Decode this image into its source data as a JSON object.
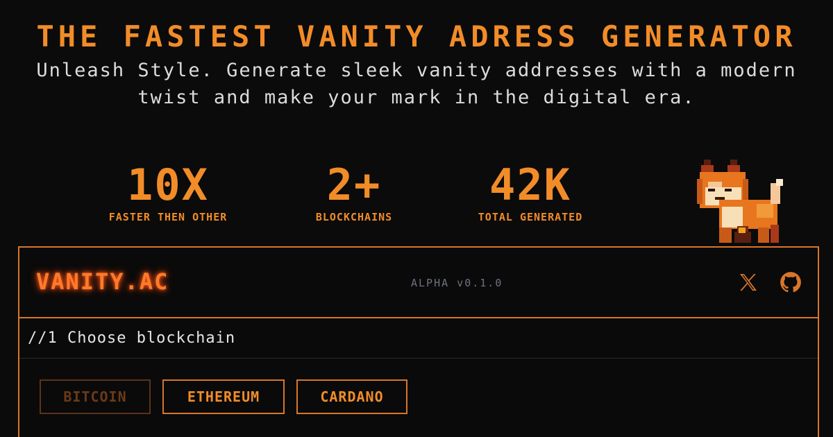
{
  "hero": {
    "title": "THE FASTEST VANITY ADRESS GENERATOR",
    "subtitle_line1": "Unleash Style. Generate sleek vanity addresses with a modern",
    "subtitle_line2": "twist and make your mark in the digital era."
  },
  "stats": [
    {
      "value": "10X",
      "label": "FASTER THEN OTHER"
    },
    {
      "value": "2+",
      "label": "BLOCKCHAINS"
    },
    {
      "value": "42K",
      "label": "TOTAL GENERATED"
    }
  ],
  "app": {
    "brand": "VANITY.AC",
    "version": "ALPHA v0.1.0",
    "icons": [
      "x-icon",
      "github-icon"
    ]
  },
  "step": {
    "label": "//1 Choose blockchain"
  },
  "chains": [
    {
      "label": "BITCOIN",
      "state": "disabled"
    },
    {
      "label": "ETHEREUM",
      "state": "enabled"
    },
    {
      "label": "CARDANO",
      "state": "enabled"
    }
  ],
  "colors": {
    "accent": "#f28c28",
    "border": "#d9762a",
    "background": "#0b0b0b",
    "muted": "#6f7380"
  }
}
